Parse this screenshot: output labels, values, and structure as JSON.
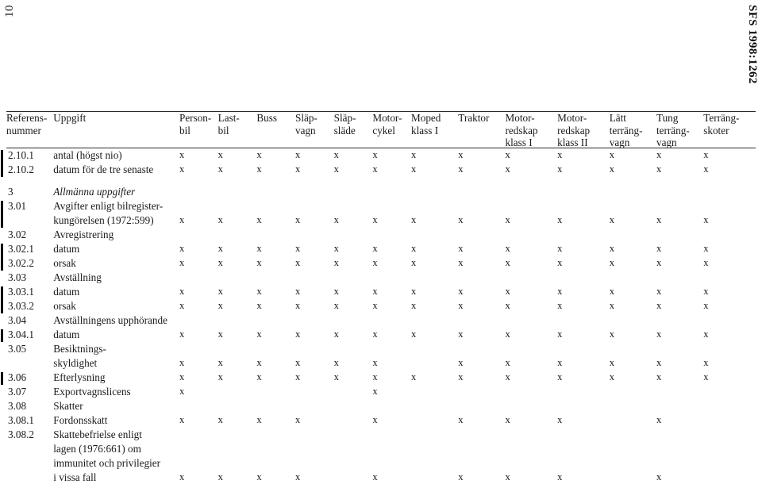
{
  "page": {
    "folio": "10",
    "sfs_reference": "SFS 1998:1262"
  },
  "table": {
    "columns": [
      {
        "key": "ref",
        "label": "Referens-\nnummer"
      },
      {
        "key": "lab",
        "label": "Uppgift"
      },
      {
        "key": "m1",
        "label": "Person-\nbil"
      },
      {
        "key": "m2",
        "label": "Last-\nbil"
      },
      {
        "key": "m3",
        "label": "Buss"
      },
      {
        "key": "m4",
        "label": "Släp-\nvagn"
      },
      {
        "key": "m5",
        "label": "Släp-\nsläde"
      },
      {
        "key": "m6",
        "label": "Motor-\ncykel"
      },
      {
        "key": "m7",
        "label": "Moped\nklass I"
      },
      {
        "key": "m8",
        "label": "Traktor"
      },
      {
        "key": "m9",
        "label": "Motor-\nredskap\nklass I"
      },
      {
        "key": "m10",
        "label": "Motor-\nredskap\nklass II"
      },
      {
        "key": "m11",
        "label": "Lätt\nterräng-\nvagn"
      },
      {
        "key": "m12",
        "label": "Tung\nterräng-\nvagn"
      },
      {
        "key": "m13",
        "label": "Terräng-\nskoter"
      }
    ],
    "mark": "x",
    "rows": [
      {
        "type": "row",
        "ref": "2.10.1",
        "label": "antal (högst nio)",
        "italic": false,
        "changed": true,
        "marks": [
          1,
          1,
          1,
          1,
          1,
          1,
          1,
          1,
          1,
          1,
          1,
          1,
          1
        ]
      },
      {
        "type": "row",
        "ref": "2.10.2",
        "label": "datum för de tre senaste",
        "italic": false,
        "changed": true,
        "marks": [
          1,
          1,
          1,
          1,
          1,
          1,
          1,
          1,
          1,
          1,
          1,
          1,
          1
        ]
      },
      {
        "type": "gap"
      },
      {
        "type": "row",
        "ref": "3",
        "label": "Allmänna uppgifter",
        "italic": true,
        "changed": false,
        "marks": [
          0,
          0,
          0,
          0,
          0,
          0,
          0,
          0,
          0,
          0,
          0,
          0,
          0
        ]
      },
      {
        "type": "row",
        "ref": "3.01",
        "label": "Avgifter enligt bilregister-",
        "italic": false,
        "changed": true,
        "marks": [
          0,
          0,
          0,
          0,
          0,
          0,
          0,
          0,
          0,
          0,
          0,
          0,
          0
        ]
      },
      {
        "type": "row",
        "ref": "",
        "label": "kungörelsen (1972:599)",
        "italic": false,
        "changed": true,
        "marks": [
          1,
          1,
          1,
          1,
          1,
          1,
          1,
          1,
          1,
          1,
          1,
          1,
          1
        ]
      },
      {
        "type": "row",
        "ref": "3.02",
        "label": "Avregistrering",
        "italic": false,
        "changed": false,
        "marks": [
          0,
          0,
          0,
          0,
          0,
          0,
          0,
          0,
          0,
          0,
          0,
          0,
          0
        ]
      },
      {
        "type": "row",
        "ref": "3.02.1",
        "label": "datum",
        "italic": false,
        "changed": true,
        "marks": [
          1,
          1,
          1,
          1,
          1,
          1,
          1,
          1,
          1,
          1,
          1,
          1,
          1
        ]
      },
      {
        "type": "row",
        "ref": "3.02.2",
        "label": "orsak",
        "italic": false,
        "changed": true,
        "marks": [
          1,
          1,
          1,
          1,
          1,
          1,
          1,
          1,
          1,
          1,
          1,
          1,
          1
        ]
      },
      {
        "type": "row",
        "ref": "3.03",
        "label": "Avställning",
        "italic": false,
        "changed": false,
        "marks": [
          0,
          0,
          0,
          0,
          0,
          0,
          0,
          0,
          0,
          0,
          0,
          0,
          0
        ]
      },
      {
        "type": "row",
        "ref": "3.03.1",
        "label": "datum",
        "italic": false,
        "changed": true,
        "marks": [
          1,
          1,
          1,
          1,
          1,
          1,
          1,
          1,
          1,
          1,
          1,
          1,
          1
        ]
      },
      {
        "type": "row",
        "ref": "3.03.2",
        "label": "orsak",
        "italic": false,
        "changed": true,
        "marks": [
          1,
          1,
          1,
          1,
          1,
          1,
          1,
          1,
          1,
          1,
          1,
          1,
          1
        ]
      },
      {
        "type": "row",
        "ref": "3.04",
        "label": "Avställningens upphörande",
        "italic": false,
        "changed": false,
        "marks": [
          0,
          0,
          0,
          0,
          0,
          0,
          0,
          0,
          0,
          0,
          0,
          0,
          0
        ]
      },
      {
        "type": "row",
        "ref": "3.04.1",
        "label": "datum",
        "italic": false,
        "changed": true,
        "marks": [
          1,
          1,
          1,
          1,
          1,
          1,
          1,
          1,
          1,
          1,
          1,
          1,
          1
        ]
      },
      {
        "type": "row",
        "ref": "3.05",
        "label": "Besiktnings-",
        "italic": false,
        "changed": false,
        "marks": [
          0,
          0,
          0,
          0,
          0,
          0,
          0,
          0,
          0,
          0,
          0,
          0,
          0
        ]
      },
      {
        "type": "row",
        "ref": "",
        "label": "skyldighet",
        "italic": false,
        "changed": false,
        "marks": [
          1,
          1,
          1,
          1,
          1,
          1,
          0,
          1,
          1,
          1,
          1,
          1,
          1
        ]
      },
      {
        "type": "row",
        "ref": "3.06",
        "label": "Efterlysning",
        "italic": false,
        "changed": true,
        "marks": [
          1,
          1,
          1,
          1,
          1,
          1,
          1,
          1,
          1,
          1,
          1,
          1,
          1
        ]
      },
      {
        "type": "row",
        "ref": "3.07",
        "label": "Exportvagnslicens",
        "italic": false,
        "changed": false,
        "marks": [
          1,
          0,
          0,
          0,
          0,
          1,
          0,
          0,
          0,
          0,
          0,
          0,
          0
        ]
      },
      {
        "type": "row",
        "ref": "3.08",
        "label": "Skatter",
        "italic": false,
        "changed": false,
        "marks": [
          0,
          0,
          0,
          0,
          0,
          0,
          0,
          0,
          0,
          0,
          0,
          0,
          0
        ]
      },
      {
        "type": "row",
        "ref": "3.08.1",
        "label": "Fordonsskatt",
        "italic": false,
        "changed": false,
        "marks": [
          1,
          1,
          1,
          1,
          0,
          1,
          0,
          1,
          1,
          1,
          0,
          1,
          0
        ]
      },
      {
        "type": "row",
        "ref": "3.08.2",
        "label": "Skattebefrielse enligt",
        "italic": false,
        "changed": false,
        "marks": [
          0,
          0,
          0,
          0,
          0,
          0,
          0,
          0,
          0,
          0,
          0,
          0,
          0
        ]
      },
      {
        "type": "row",
        "ref": "",
        "label": "lagen (1976:661) om",
        "italic": false,
        "changed": false,
        "marks": [
          0,
          0,
          0,
          0,
          0,
          0,
          0,
          0,
          0,
          0,
          0,
          0,
          0
        ]
      },
      {
        "type": "row",
        "ref": "",
        "label": "immunitet och privilegier",
        "italic": false,
        "changed": false,
        "marks": [
          0,
          0,
          0,
          0,
          0,
          0,
          0,
          0,
          0,
          0,
          0,
          0,
          0
        ]
      },
      {
        "type": "row",
        "ref": "",
        "label": "i vissa fall",
        "italic": false,
        "changed": false,
        "marks": [
          1,
          1,
          1,
          1,
          0,
          1,
          0,
          1,
          1,
          1,
          0,
          1,
          0
        ]
      }
    ]
  }
}
